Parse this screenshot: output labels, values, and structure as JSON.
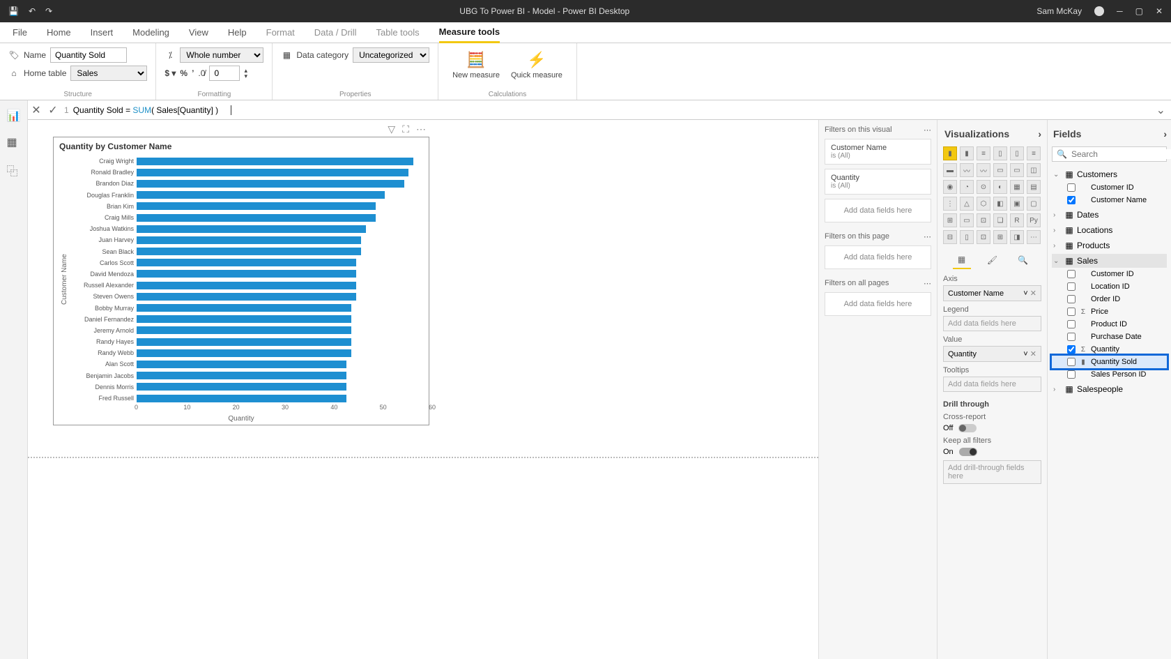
{
  "titlebar": {
    "title": "UBG To Power BI - Model - Power BI Desktop",
    "user": "Sam McKay"
  },
  "ribbon_tabs": [
    "File",
    "Home",
    "Insert",
    "Modeling",
    "View",
    "Help",
    "Format",
    "Data / Drill",
    "Table tools",
    "Measure tools"
  ],
  "ribbon_active": "Measure tools",
  "ribbon": {
    "name_label": "Name",
    "name_value": "Quantity Sold",
    "home_table_label": "Home table",
    "home_table_value": "Sales",
    "structure_label": "Structure",
    "format_value": "Whole number",
    "decimals_value": "0",
    "formatting_label": "Formatting",
    "data_category_label": "Data category",
    "data_category_value": "Uncategorized",
    "properties_label": "Properties",
    "new_measure": "New measure",
    "quick_measure": "Quick measure",
    "calculations_label": "Calculations"
  },
  "formula": {
    "line": "1",
    "measure": "Quantity Sold",
    "eq": " = ",
    "fn": "SUM",
    "args": "( Sales[Quantity] )"
  },
  "chart_data": {
    "type": "bar",
    "title": "Quantity by Customer Name",
    "ylabel_axis": "Customer Name",
    "xlabel_axis": "Quantity",
    "xticks": [
      0,
      10,
      20,
      30,
      40,
      50,
      60
    ],
    "xlim": [
      0,
      60
    ],
    "categories": [
      "Craig Wright",
      "Ronald Bradley",
      "Brandon Diaz",
      "Douglas Franklin",
      "Brian Kim",
      "Craig Mills",
      "Joshua Watkins",
      "Juan Harvey",
      "Sean Black",
      "Carlos Scott",
      "David Mendoza",
      "Russell Alexander",
      "Steven Owens",
      "Bobby Murray",
      "Daniel Fernandez",
      "Jeremy Arnold",
      "Randy Hayes",
      "Randy Webb",
      "Alan Scott",
      "Benjamin Jacobs",
      "Dennis Morris",
      "Fred Russell"
    ],
    "values": [
      58,
      57,
      56,
      52,
      50,
      50,
      48,
      47,
      47,
      46,
      46,
      46,
      46,
      45,
      45,
      45,
      45,
      45,
      44,
      44,
      44,
      44
    ]
  },
  "filters": {
    "on_visual": "Filters on this visual",
    "on_page": "Filters on this page",
    "on_all": "Filters on all pages",
    "add": "Add data fields here",
    "cards": [
      {
        "name": "Customer Name",
        "val": "is (All)"
      },
      {
        "name": "Quantity",
        "val": "is (All)"
      }
    ]
  },
  "viz": {
    "title": "Visualizations",
    "axis": "Axis",
    "axis_val": "Customer Name",
    "legend": "Legend",
    "value": "Value",
    "value_val": "Quantity",
    "tooltips": "Tooltips",
    "add": "Add data fields here",
    "drill": "Drill through",
    "cross": "Cross-report",
    "cross_val": "Off",
    "keep": "Keep all filters",
    "keep_val": "On",
    "drill_add": "Add drill-through fields here"
  },
  "fields": {
    "title": "Fields",
    "search": "Search",
    "tables": [
      {
        "name": "Customers",
        "expanded": true,
        "fields": [
          {
            "name": "Customer ID",
            "checked": false
          },
          {
            "name": "Customer Name",
            "checked": true
          }
        ]
      },
      {
        "name": "Dates",
        "expanded": false
      },
      {
        "name": "Locations",
        "expanded": false
      },
      {
        "name": "Products",
        "expanded": false
      },
      {
        "name": "Sales",
        "expanded": true,
        "selected": true,
        "fields": [
          {
            "name": "Customer ID",
            "checked": false
          },
          {
            "name": "Location ID",
            "checked": false
          },
          {
            "name": "Order ID",
            "checked": false
          },
          {
            "name": "Price",
            "checked": false,
            "sigma": true
          },
          {
            "name": "Product ID",
            "checked": false
          },
          {
            "name": "Purchase Date",
            "checked": false
          },
          {
            "name": "Quantity",
            "checked": true,
            "sigma": true
          },
          {
            "name": "Quantity Sold",
            "checked": false,
            "measure": true,
            "highlight": true
          },
          {
            "name": "Sales Person ID",
            "checked": false
          }
        ]
      },
      {
        "name": "Salespeople",
        "expanded": false
      }
    ]
  }
}
